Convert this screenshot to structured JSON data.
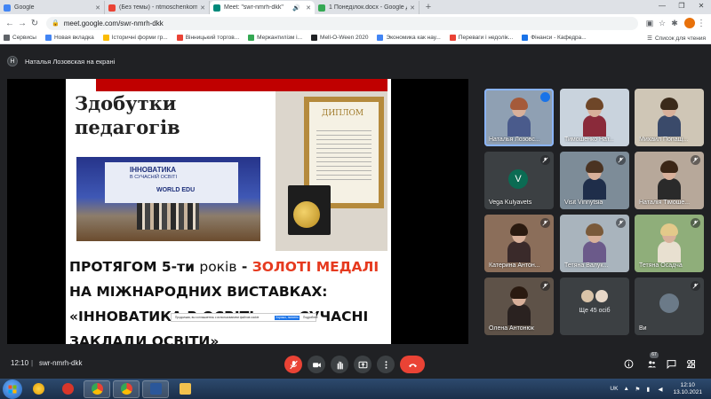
{
  "browser": {
    "tabs": [
      {
        "title": "Google",
        "color": "#4285f4",
        "active": false
      },
      {
        "title": "(Без темы) - ntmoschenkom@g",
        "color": "#ea4335",
        "active": false
      },
      {
        "title": "Meet: \"swr-nmrh-dkk\"",
        "color": "#00897b",
        "active": true
      },
      {
        "title": "1 Понеділок.docx - Google Диск",
        "color": "#34a853",
        "active": false
      }
    ],
    "address": "meet.google.com/swr-nmrh-dkk",
    "bookmarks": [
      {
        "label": "Сервисы",
        "color": "#5f6368"
      },
      {
        "label": "Новая вкладка",
        "color": "#4285f4"
      },
      {
        "label": "Історичні форми гр...",
        "color": "#fbbc04"
      },
      {
        "label": "Вінницький торгов...",
        "color": "#ea4335"
      },
      {
        "label": "Меркантилізм і...",
        "color": "#34a853"
      },
      {
        "label": "Mell-O-Ween 2020",
        "color": "#202124"
      },
      {
        "label": "Экономика как нау...",
        "color": "#4285f4"
      },
      {
        "label": "Переваги і недолік...",
        "color": "#ea4335"
      },
      {
        "label": "Фінанси - Кафедра...",
        "color": "#1a73e8"
      }
    ],
    "reading_list": "Список для чтения"
  },
  "meet": {
    "presenter_initial": "Н",
    "presenter_text": "Наталья Лозовская на екрані",
    "slide": {
      "title_line1": "Здобутки",
      "title_line2": "педагогів",
      "photo_banner_line1": "ІННОВАТИКА",
      "photo_banner_line2": "В СУЧАСНІЙ ОСВІТІ",
      "photo_banner_line3": "WORLD EDU",
      "diploma_title": "ДИПЛОМ",
      "headline_part1": "ПРОТЯГОМ 5-ти ",
      "headline_part2": "років",
      "headline_part3": " - ",
      "headline_gold": "ЗОЛОТІ МЕДАЛІ",
      "headline_part4": " НА МІЖНАРОДНИХ ВИСТАВКАХ: «ІННОВАТИКА В ОСВІТІ» та «СУЧАСНІ ЗАКЛАДИ ОСВІТИ»",
      "consent_text": "Продолжая, вы соглашаетесь с использованием файлов cookie",
      "consent_agree": "Хорошо, понятно",
      "consent_more": "Подробнее"
    },
    "participants": [
      {
        "name": "Наталья Лозовс...",
        "muted": false,
        "speaking": true
      },
      {
        "name": "Тимошенко Нат...",
        "muted": false
      },
      {
        "name": "Михаил Попащ...",
        "muted": false
      },
      {
        "name": "Vega Kulyavets",
        "muted": true,
        "initial": "V"
      },
      {
        "name": "Visit Vinnytsia",
        "muted": true
      },
      {
        "name": "Наталія Тімоше...",
        "muted": true
      },
      {
        "name": "Катерина Антон...",
        "muted": true
      },
      {
        "name": "Тетяна Валук...",
        "muted": true
      },
      {
        "name": "Тетяна Осадча",
        "muted": true
      },
      {
        "name": "Олена Антонюк",
        "muted": true
      },
      {
        "name": "",
        "more_text": "Ще 45 осіб"
      },
      {
        "name": "Ви",
        "muted": true
      }
    ],
    "time": "12:10",
    "meeting_code": "swr-nmrh-dkk",
    "participant_count": "67"
  },
  "taskbar": {
    "language": "UK",
    "time": "12:10",
    "date": "13.10.2021"
  }
}
